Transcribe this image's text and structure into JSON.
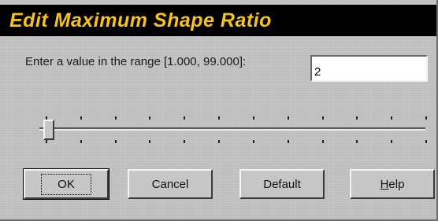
{
  "dialog": {
    "title": "Edit Maximum Shape Ratio",
    "prompt": "Enter a value in the range [1.000, 99.000]:",
    "value": "2"
  },
  "slider": {
    "min": 1.0,
    "max": 99.0,
    "value": 2.0,
    "tick_count": 12
  },
  "buttons": {
    "ok_label": "OK",
    "cancel_label": "Cancel",
    "default_label": "Default",
    "help_mnemonic": "H",
    "help_rest": "elp"
  },
  "colors": {
    "title_text": "#f7c31b",
    "title_bar": "#000000",
    "dialog_bg": "#c4c4c4"
  }
}
